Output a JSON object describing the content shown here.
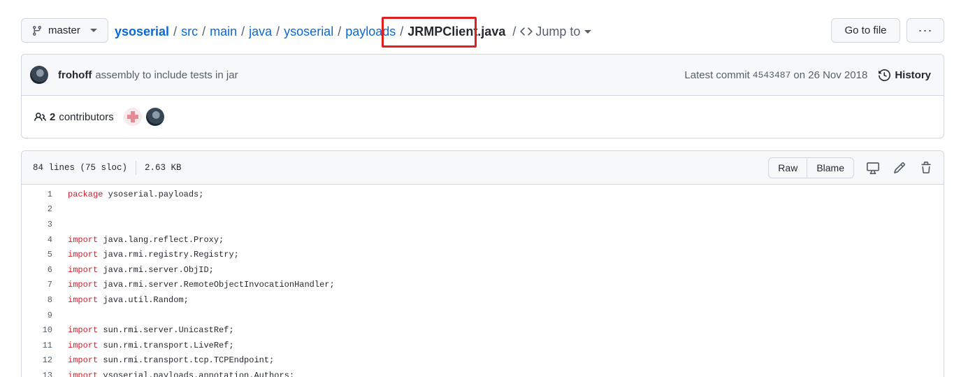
{
  "branch": {
    "label": "master"
  },
  "breadcrumb": {
    "repo": "ysoserial",
    "parts": [
      "src",
      "main",
      "java",
      "ysoserial",
      "payloads"
    ],
    "file": "JRMPClient.java",
    "jump_to": "Jump to"
  },
  "actions": {
    "go_to_file": "Go to file",
    "more": "···"
  },
  "commit": {
    "author": "frohoff",
    "message": "assembly to include tests in jar",
    "prefix": "Latest commit",
    "sha": "4543487",
    "date_text": "on 26 Nov 2018",
    "history_label": "History"
  },
  "contributors": {
    "count": "2",
    "label": "contributors"
  },
  "file_info": {
    "lines": "84 lines (75 sloc)",
    "size": "2.63 KB",
    "raw_label": "Raw",
    "blame_label": "Blame"
  },
  "code_lines": [
    {
      "num": "1",
      "kw": "package",
      "rest": " ysoserial.payloads;"
    },
    {
      "num": "2",
      "kw": "",
      "rest": ""
    },
    {
      "num": "3",
      "kw": "",
      "rest": ""
    },
    {
      "num": "4",
      "kw": "import",
      "rest": " java.lang.reflect.Proxy;"
    },
    {
      "num": "5",
      "kw": "import",
      "rest": " java.rmi.registry.Registry;"
    },
    {
      "num": "6",
      "kw": "import",
      "rest": " java.rmi.server.ObjID;"
    },
    {
      "num": "7",
      "kw": "import",
      "rest": " java.rmi.server.RemoteObjectInvocationHandler;"
    },
    {
      "num": "8",
      "kw": "import",
      "rest": " java.util.Random;"
    },
    {
      "num": "9",
      "kw": "",
      "rest": ""
    },
    {
      "num": "10",
      "kw": "import",
      "rest": " sun.rmi.server.UnicastRef;"
    },
    {
      "num": "11",
      "kw": "import",
      "rest": " sun.rmi.transport.LiveRef;"
    },
    {
      "num": "12",
      "kw": "import",
      "rest": " sun.rmi.transport.tcp.TCPEndpoint;"
    },
    {
      "num": "13",
      "kw": "import",
      "rest": " ysoserial.payloads.annotation.Authors;"
    }
  ],
  "colors": {
    "link": "#0969da",
    "keyword": "#cf222e",
    "highlight_box": "#e0201f"
  }
}
